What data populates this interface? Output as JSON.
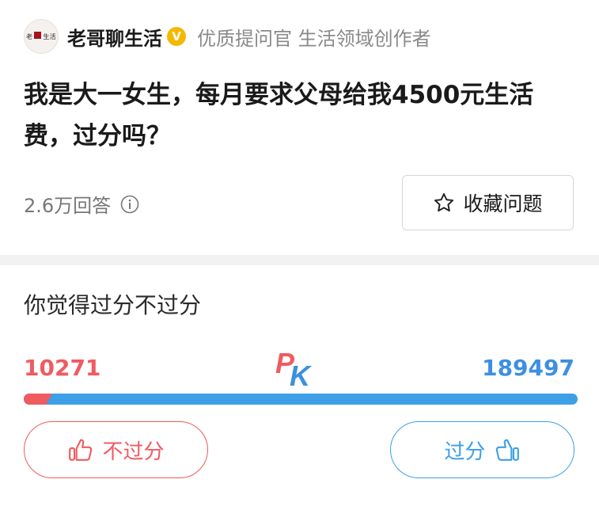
{
  "author": {
    "name": "老哥聊生活",
    "avatar_text": "老哥聊生活",
    "description": "优质提问官 生活领域创作者",
    "verified_mark": "V"
  },
  "question": {
    "title": "我是大一女生，每月要求父母给我4500元生活费，过分吗？",
    "answer_count": "2.6万回答",
    "favorite_label": "收藏问题"
  },
  "poll": {
    "question": "你觉得过分不过分",
    "left_count": "10271",
    "right_count": "189497",
    "left_fraction": 0.0514,
    "pk_p": "P",
    "pk_k": "K",
    "left_label": "不过分",
    "right_label": "过分",
    "colors": {
      "left": "#ef5b61",
      "right": "#3d9fe6"
    }
  },
  "icons": [
    "info-icon",
    "star-icon",
    "thumbs-up-icon"
  ]
}
